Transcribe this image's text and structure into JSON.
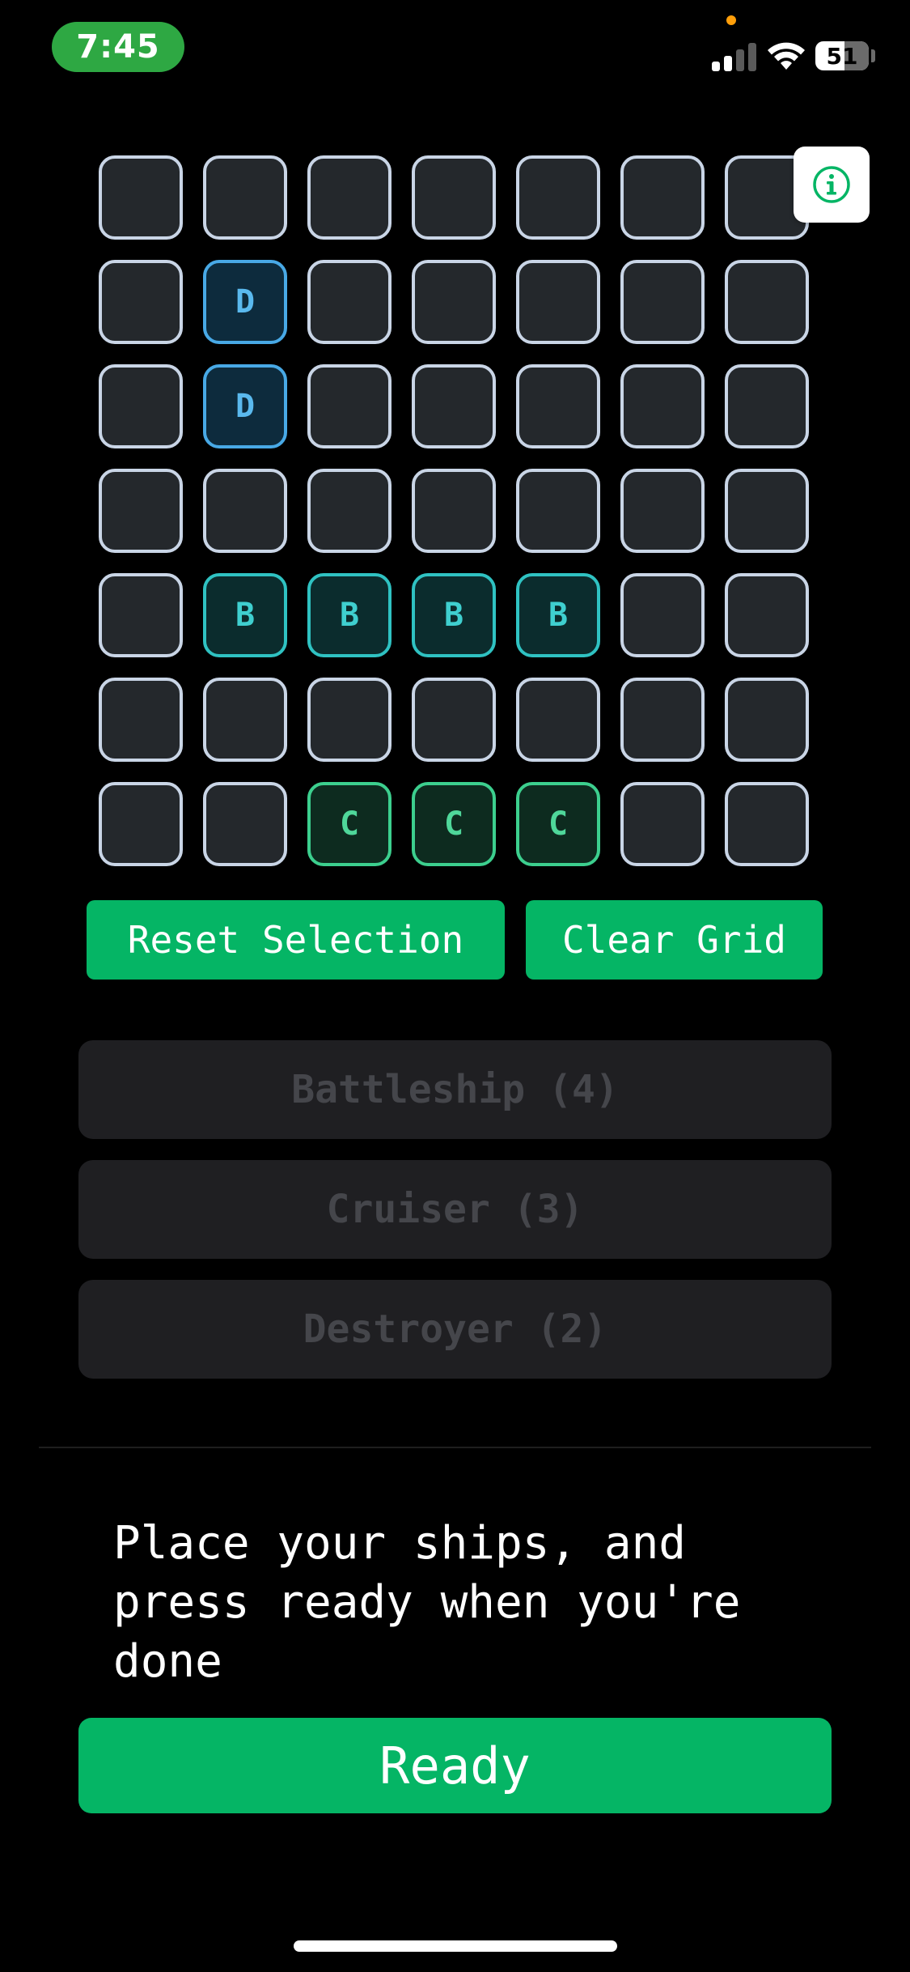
{
  "status_bar": {
    "time": "7:45",
    "battery": "51"
  },
  "grid": {
    "rows": [
      [
        "",
        "",
        "",
        "",
        "",
        "",
        ""
      ],
      [
        "",
        "D",
        "",
        "",
        "",
        "",
        ""
      ],
      [
        "",
        "D",
        "",
        "",
        "",
        "",
        ""
      ],
      [
        "",
        "",
        "",
        "",
        "",
        "",
        ""
      ],
      [
        "",
        "B",
        "B",
        "B",
        "B",
        "",
        ""
      ],
      [
        "",
        "",
        "",
        "",
        "",
        "",
        ""
      ],
      [
        "",
        "",
        "C",
        "C",
        "C",
        "",
        ""
      ]
    ]
  },
  "info_button": {
    "icon": "info-circle-icon"
  },
  "actions": {
    "reset_label": "Reset Selection",
    "clear_label": "Clear Grid"
  },
  "ships": [
    {
      "label": "Battleship (4)"
    },
    {
      "label": "Cruiser (3)"
    },
    {
      "label": "Destroyer (2)"
    }
  ],
  "instructions": "Place your ships, and press ready when you're done",
  "ready_label": "Ready",
  "colors": {
    "accent": "#05b565",
    "destroyer": "#48a9e6",
    "battleship": "#2fc2c2",
    "cruiser": "#3ccf8e"
  }
}
